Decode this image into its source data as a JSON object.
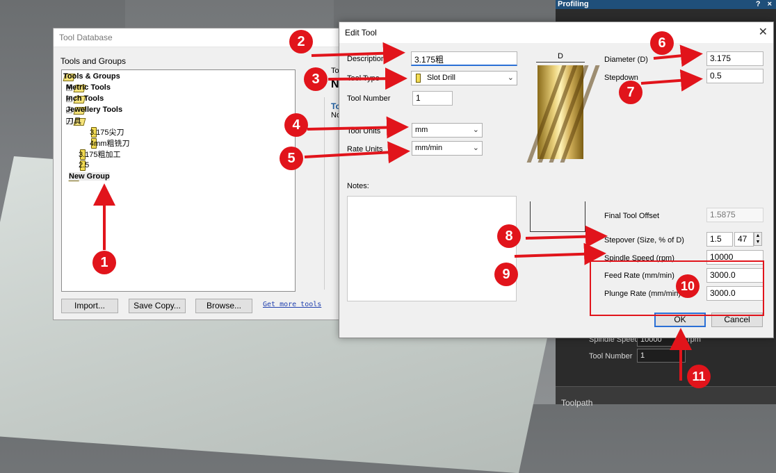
{
  "profiling": {
    "title": "Profiling",
    "help": "?",
    "close": "×",
    "spindle_label": "Spindle Speed",
    "spindle_value": "10000",
    "rpm": "rpm",
    "toolnum_label": "Tool Number",
    "toolnum_value": "1",
    "toolpath_label": "Toolpath"
  },
  "tool_db": {
    "title": "Tool Database",
    "sub_label": "Tools and Groups",
    "tree": [
      {
        "label": "Tools & Groups"
      },
      {
        "label": "Metric Tools"
      },
      {
        "label": "Inch Tools"
      },
      {
        "label": "Jewellery Tools"
      },
      {
        "label": "刀具"
      },
      {
        "label": "3.175尖刀"
      },
      {
        "label": "4mm粗铣刀"
      },
      {
        "label": "3.175粗加工"
      },
      {
        "label": "2.5"
      },
      {
        "label": "New Group"
      }
    ],
    "buttons": {
      "import": "Import...",
      "save_copy": "Save Copy...",
      "browse": "Browse..."
    },
    "link": "Get more tools",
    "right_frag": {
      "to": "To",
      "n": "N",
      "to2": "To",
      "no": "No"
    }
  },
  "edit_tool": {
    "title": "Edit Tool",
    "close": "✕",
    "description_label": "Description",
    "description_value": "3.175粗",
    "tool_type_label": "Tool Type",
    "tool_type_value": "Slot Drill",
    "tool_number_label": "Tool Number",
    "tool_number_value": "1",
    "tool_units_label": "Tool Units",
    "tool_units_value": "mm",
    "rate_units_label": "Rate Units",
    "rate_units_value": "mm/min",
    "notes_label": "Notes:",
    "diameter_label": "Diameter (D)",
    "diameter_value": "3.175",
    "stepdown_label": "Stepdown",
    "stepdown_value": "0.5",
    "d_marker": "D",
    "final_offset_label": "Final Tool Offset",
    "final_offset_value": "1.5875",
    "stepover_label": "Stepover (Size, % of D)",
    "stepover_size": "1.5",
    "stepover_pct": "47",
    "spindle_label": "Spindle Speed (rpm)",
    "spindle_value": "10000",
    "feed_label": "Feed Rate (mm/min)",
    "feed_value": "3000.0",
    "plunge_label": "Plunge Rate (mm/min)",
    "plunge_value": "3000.0",
    "ok": "OK",
    "cancel": "Cancel"
  },
  "annotations": [
    "1",
    "2",
    "3",
    "4",
    "5",
    "6",
    "7",
    "8",
    "9",
    "10",
    "11"
  ],
  "colors": {
    "annotation_red": "#e1141b",
    "accent_blue": "#2a6fd6",
    "panel_title_blue": "#1f4f7a"
  }
}
